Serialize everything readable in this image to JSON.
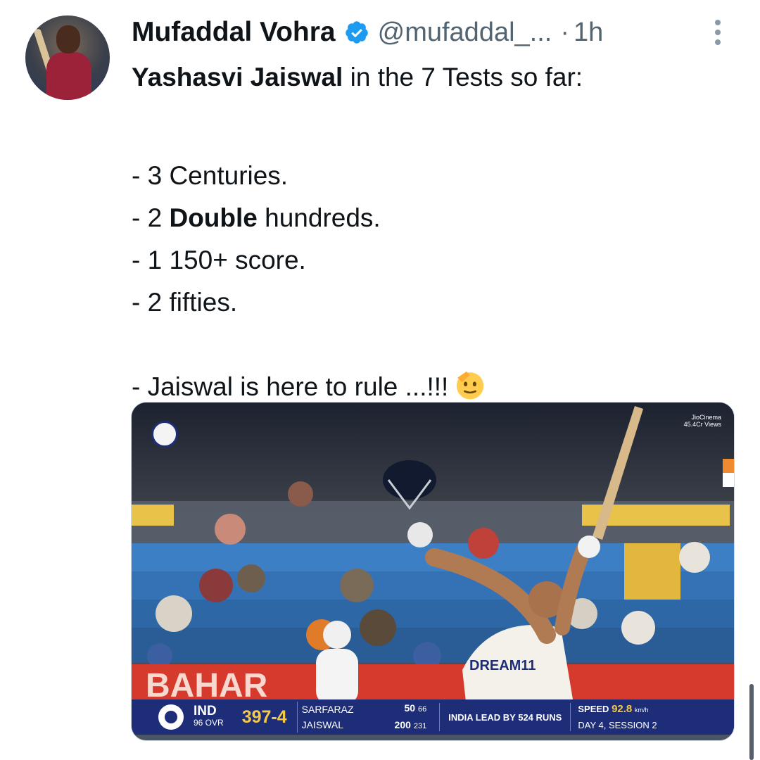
{
  "tweet": {
    "author_name": "Mufaddal Vohra",
    "handle": "@mufaddal_...",
    "separator": "·",
    "time": "1h",
    "lines": {
      "l1_bold": "Yashasvi Jaiswal",
      "l1_rest": " in the 7 Tests so far:",
      "l2": "- 3 Centuries.",
      "l3_pre": "- 2 ",
      "l3_bold": "Double",
      "l3_post": " hundreds.",
      "l4": "- 1 150+ score.",
      "l5": "- 2 fifties.",
      "l6": "- Jaiswal is here to rule ...!!!"
    },
    "emoji": "saluting-face"
  },
  "media": {
    "watermark_line1": "JioCinema",
    "watermark_line2": "45.4Cr Views",
    "jersey_text": "DREAM11",
    "board_text": "BAHAR",
    "scorebar": {
      "team": "IND",
      "overs": "96 OVR",
      "score": "397-4",
      "batter1": "SARFARAZ",
      "batter1_runs": "50",
      "batter1_balls": "66",
      "batter2": "JAISWAL",
      "batter2_runs": "200",
      "batter2_balls": "231",
      "lead": "INDIA LEAD BY 524 RUNS",
      "speed_label": "SPEED",
      "speed_value": "92.8",
      "speed_unit": "km/h",
      "day_session": "DAY 4, SESSION 2"
    }
  },
  "colors": {
    "verified": "#1d9bf0",
    "text_primary": "#0f1419",
    "text_secondary": "#536471",
    "scorebar_bg": "#1d2d78",
    "score_highlight": "#f6c945"
  }
}
